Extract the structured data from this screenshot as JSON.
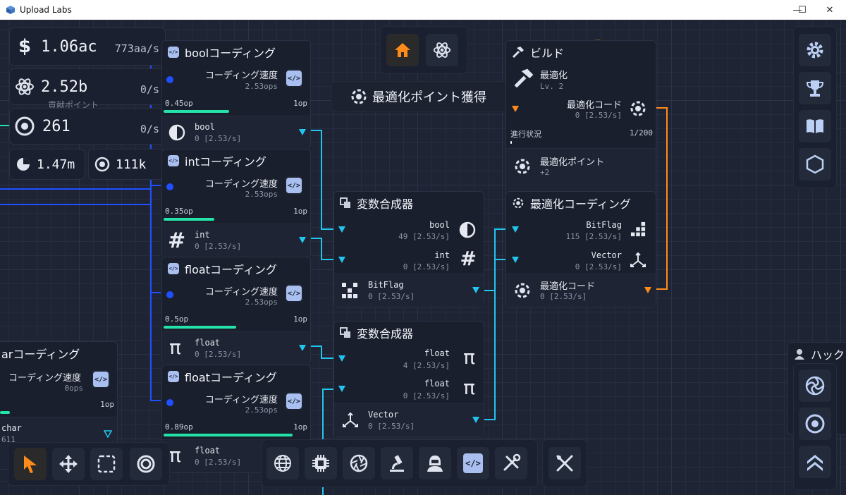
{
  "window": {
    "title": "Upload Labs",
    "minimize": "—",
    "maximize": "☐",
    "close": "✕"
  },
  "stats": {
    "money": {
      "value": "1.06ac",
      "rate": "773aa/s"
    },
    "research": {
      "value": "2.52b",
      "rate": "0/s"
    },
    "tokens": {
      "value": "261",
      "rate": "0/s"
    },
    "pie": {
      "value": "1.47m"
    },
    "cycle": {
      "value": "111k"
    },
    "hidden_label": "貢献ポイント"
  },
  "toast": {
    "text": "最適化ポイント獲得"
  },
  "nodes": {
    "bool_coding": {
      "title": "boolコーディング",
      "speed_label": "コーディング速度",
      "speed": "2.53ops",
      "progress": "0.45op",
      "cap": "1op",
      "progress_fraction": 0.45,
      "out_name": "bool",
      "out_rate": "0 [2.53/s]"
    },
    "int_coding": {
      "title": "intコーディング",
      "speed_label": "コーディング速度",
      "speed": "2.53ops",
      "progress": "0.35op",
      "cap": "1op",
      "progress_fraction": 0.35,
      "out_name": "int",
      "out_rate": "0 [2.53/s]"
    },
    "float_coding_1": {
      "title": "floatコーディング",
      "speed_label": "コーディング速度",
      "speed": "2.53ops",
      "progress": "0.5op",
      "cap": "1op",
      "progress_fraction": 0.5,
      "out_name": "float",
      "out_rate": "0 [2.53/s]"
    },
    "float_coding_2": {
      "title": "floatコーディング",
      "speed_label": "コーディング速度",
      "speed": "2.53ops",
      "progress": "0.89op",
      "cap": "1op",
      "progress_fraction": 0.89,
      "out_name": "float",
      "out_rate": "0 [2.53/s]"
    },
    "char_coding": {
      "title": "arコーディング",
      "speed_label": "コーディング速度",
      "speed": "0ops",
      "cap": "1op",
      "progress_fraction": 0.08,
      "out_name": "char",
      "out_rate": "611"
    },
    "combiner_1": {
      "title": "変数合成器",
      "in1_name": "bool",
      "in1_rate": "49 [2.53/s]",
      "in2_name": "int",
      "in2_rate": "0 [2.53/s]",
      "out_name": "BitFlag",
      "out_rate": "0 [2.53/s]"
    },
    "combiner_2": {
      "title": "変数合成器",
      "in1_name": "float",
      "in1_rate": "4 [2.53/s]",
      "in2_name": "float",
      "in2_rate": "0 [2.53/s]",
      "out_name": "Vector",
      "out_rate": "0 [2.53/s]"
    },
    "build": {
      "title": "ビルド",
      "item": "最適化",
      "level": "Lv. 2",
      "input_name": "最適化コード",
      "input_rate": "0 [2.53/s]",
      "progress_label": "進行状況",
      "progress": "1/200",
      "progress_fraction": 0.005,
      "reward_name": "最適化ポイント",
      "reward_value": "+2"
    },
    "opt_coding": {
      "title": "最適化コーディング",
      "in1_name": "BitFlag",
      "in1_rate": "115 [2.53/s]",
      "in2_name": "Vector",
      "in2_rate": "0 [2.53/s]",
      "out_name": "最適化コード",
      "out_rate": "0 [2.53/s]"
    },
    "hack": {
      "title": "ハック"
    }
  },
  "colors": {
    "accent": "#ff8c1a",
    "wire_blue": "#1f4fff",
    "wire_cyan": "#22c5ee",
    "progress": "#24e3a8",
    "background": "#1e2434"
  }
}
